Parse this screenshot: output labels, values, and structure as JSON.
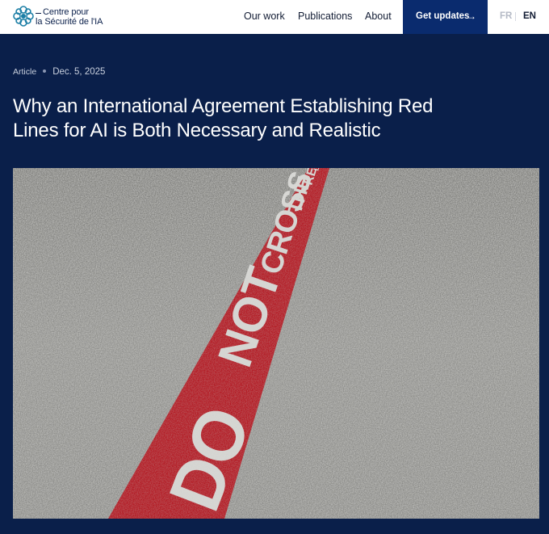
{
  "header": {
    "logo": {
      "line1": "Centre pour",
      "line2": "la Sécurité de l'IA"
    },
    "nav": [
      {
        "label": "Our work"
      },
      {
        "label": "Publications"
      },
      {
        "label": "About"
      }
    ],
    "cta": {
      "label": "Get updates",
      "icon": "arrow-right-icon"
    },
    "languages": {
      "fr": "FR",
      "en": "EN",
      "active": "EN"
    }
  },
  "article": {
    "type": "Article",
    "date": "Dec. 5, 2025",
    "title": "Why an International Agreement Establishing Red Lines for AI is Both Necessary and Realistic",
    "image": {
      "painted_text": "DO NOT CROSS THE RED LINE"
    }
  },
  "colors": {
    "navy": "#0a1f4a",
    "cta": "#0a2b6e",
    "logo_teal": "#1d7fa6",
    "road_red": "#b3121c",
    "asphalt": "#8b8b88"
  }
}
